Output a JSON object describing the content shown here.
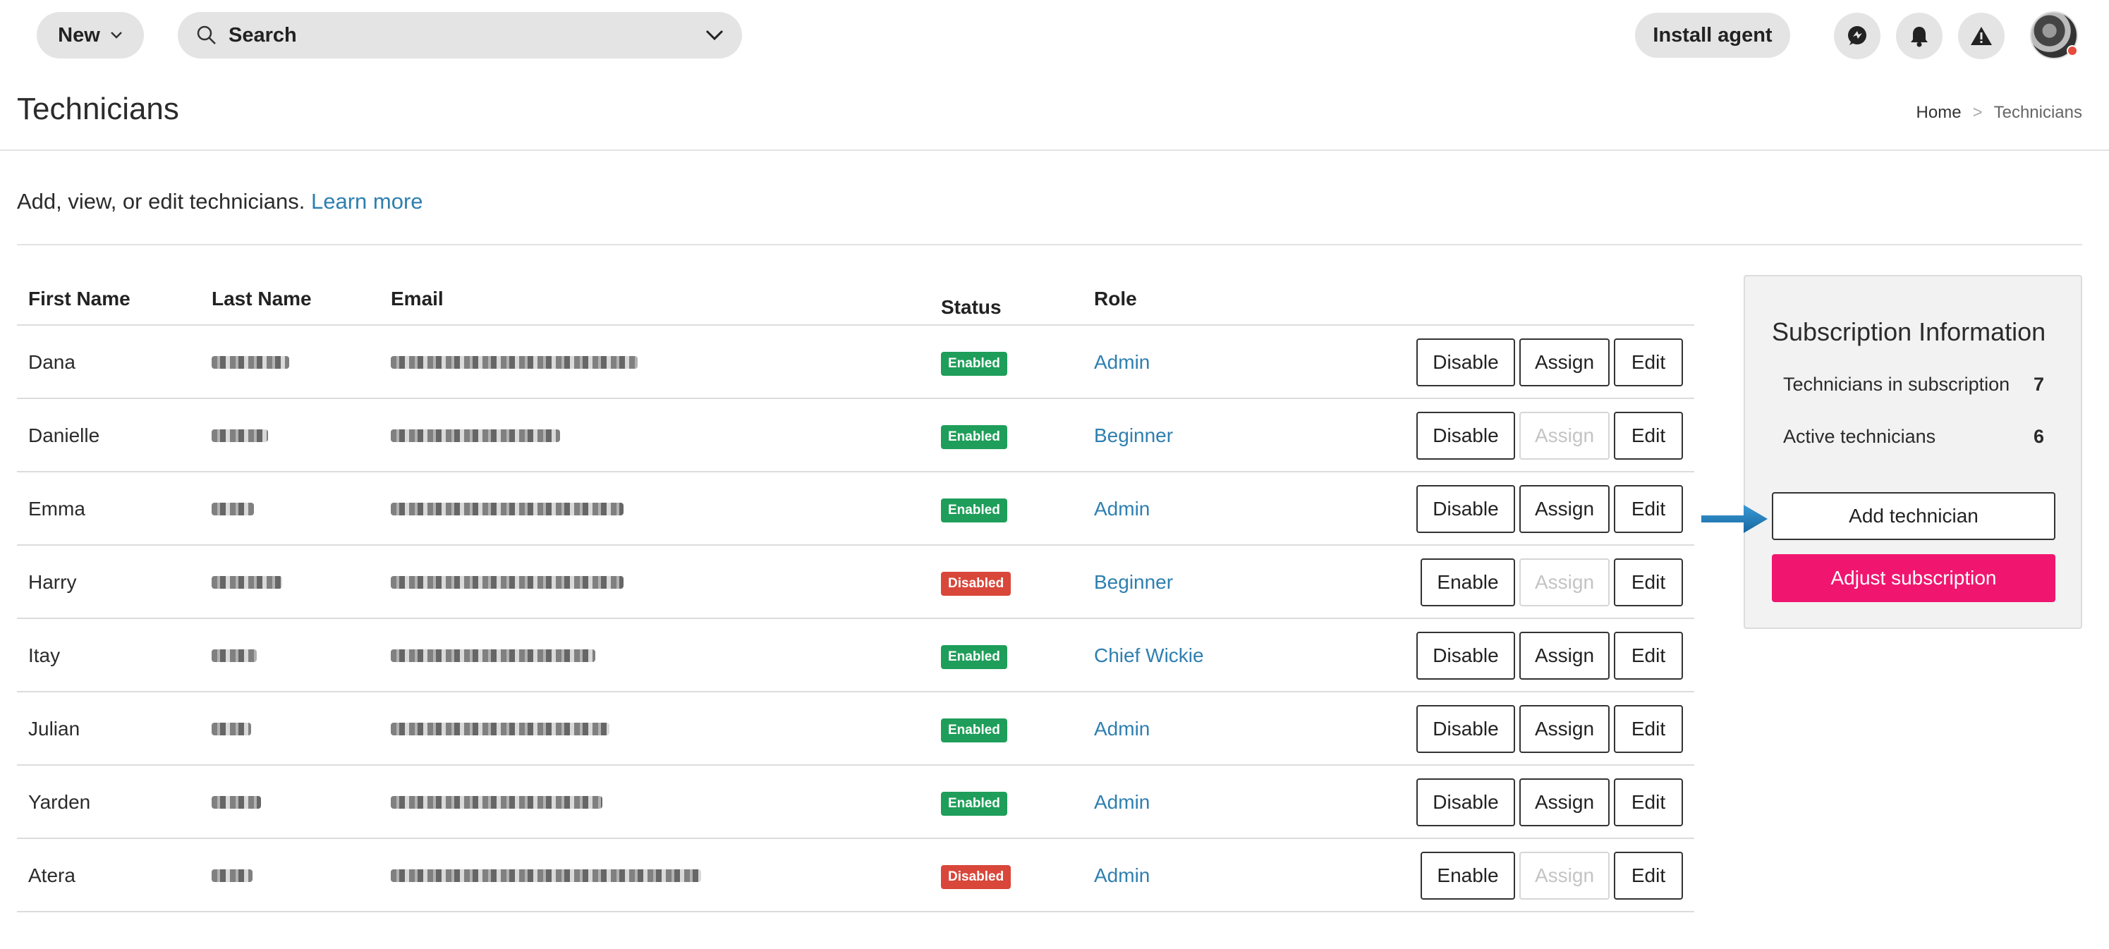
{
  "topbar": {
    "new_label": "New",
    "search_label": "Search",
    "install_label": "Install agent"
  },
  "header": {
    "title": "Technicians",
    "breadcrumb": [
      "Home",
      "Technicians"
    ],
    "breadcrumb_sep": ">"
  },
  "description": {
    "text": "Add, view, or edit technicians.",
    "link": "Learn more"
  },
  "table": {
    "columns": [
      "First Name",
      "Last Name",
      "Email",
      "Status",
      "Role"
    ],
    "rows": [
      {
        "first": "Dana",
        "status": "Enabled",
        "role": "Admin",
        "toggle": "Disable",
        "assign": "Assign",
        "assign_enabled": true,
        "edit": "Edit"
      },
      {
        "first": "Danielle",
        "status": "Enabled",
        "role": "Beginner",
        "toggle": "Disable",
        "assign": "Assign",
        "assign_enabled": false,
        "edit": "Edit"
      },
      {
        "first": "Emma",
        "status": "Enabled",
        "role": "Admin",
        "toggle": "Disable",
        "assign": "Assign",
        "assign_enabled": true,
        "edit": "Edit"
      },
      {
        "first": "Harry",
        "status": "Disabled",
        "role": "Beginner",
        "toggle": "Enable",
        "assign": "Assign",
        "assign_enabled": false,
        "edit": "Edit"
      },
      {
        "first": "Itay",
        "status": "Enabled",
        "role": "Chief Wickie",
        "toggle": "Disable",
        "assign": "Assign",
        "assign_enabled": true,
        "edit": "Edit"
      },
      {
        "first": "Julian",
        "status": "Enabled",
        "role": "Admin",
        "toggle": "Disable",
        "assign": "Assign",
        "assign_enabled": true,
        "edit": "Edit"
      },
      {
        "first": "Yarden",
        "status": "Enabled",
        "role": "Admin",
        "toggle": "Disable",
        "assign": "Assign",
        "assign_enabled": true,
        "edit": "Edit"
      },
      {
        "first": "Atera",
        "status": "Disabled",
        "role": "Admin",
        "toggle": "Enable",
        "assign": "Assign",
        "assign_enabled": false,
        "edit": "Edit"
      }
    ]
  },
  "subscription": {
    "title": "Subscription Information",
    "in_subscription_label": "Technicians in subscription",
    "in_subscription_value": "7",
    "active_label": "Active technicians",
    "active_value": "6",
    "add_label": "Add technician",
    "adjust_label": "Adjust subscription"
  },
  "colors": {
    "enabled": "#1e9e5a",
    "disabled": "#d9463a",
    "link": "#2e7fb0",
    "adjust": "#f0166f",
    "arrow": "#1f7fc0"
  },
  "icons": [
    "chevron-down-icon",
    "search-icon",
    "chat-icon",
    "bell-icon",
    "warning-icon",
    "avatar",
    "arrow-right-icon"
  ]
}
